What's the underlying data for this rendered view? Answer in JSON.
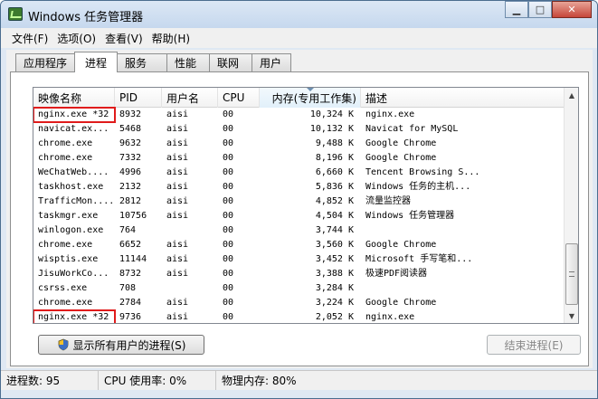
{
  "window": {
    "title": "Windows 任务管理器"
  },
  "menu": [
    "文件(F)",
    "选项(O)",
    "查看(V)",
    "帮助(H)"
  ],
  "tabs": [
    {
      "label": "应用程序",
      "active": false
    },
    {
      "label": "进程",
      "active": true
    },
    {
      "label": "服务",
      "active": false
    },
    {
      "label": "性能",
      "active": false
    },
    {
      "label": "联网",
      "active": false
    },
    {
      "label": "用户",
      "active": false
    }
  ],
  "columns": [
    {
      "key": "image",
      "label": "映像名称"
    },
    {
      "key": "pid",
      "label": "PID"
    },
    {
      "key": "user",
      "label": "用户名"
    },
    {
      "key": "cpu",
      "label": "CPU"
    },
    {
      "key": "mem",
      "label": "内存(专用工作集)"
    },
    {
      "key": "desc",
      "label": "描述"
    }
  ],
  "processes": [
    {
      "image": "nginx.exe *32",
      "pid": "8932",
      "user": "aisi",
      "cpu": "00",
      "mem": "10,324 K",
      "desc": "nginx.exe",
      "highlight": true
    },
    {
      "image": "navicat.ex...",
      "pid": "5468",
      "user": "aisi",
      "cpu": "00",
      "mem": "10,132 K",
      "desc": "Navicat for MySQL"
    },
    {
      "image": "chrome.exe",
      "pid": "9632",
      "user": "aisi",
      "cpu": "00",
      "mem": "9,488 K",
      "desc": "Google Chrome"
    },
    {
      "image": "chrome.exe",
      "pid": "7332",
      "user": "aisi",
      "cpu": "00",
      "mem": "8,196 K",
      "desc": "Google Chrome"
    },
    {
      "image": "WeChatWeb....",
      "pid": "4996",
      "user": "aisi",
      "cpu": "00",
      "mem": "6,660 K",
      "desc": "Tencent Browsing S..."
    },
    {
      "image": "taskhost.exe",
      "pid": "2132",
      "user": "aisi",
      "cpu": "00",
      "mem": "5,836 K",
      "desc": "Windows 任务的主机..."
    },
    {
      "image": "TrafficMon....",
      "pid": "2812",
      "user": "aisi",
      "cpu": "00",
      "mem": "4,852 K",
      "desc": "流量监控器"
    },
    {
      "image": "taskmgr.exe",
      "pid": "10756",
      "user": "aisi",
      "cpu": "00",
      "mem": "4,504 K",
      "desc": "Windows 任务管理器"
    },
    {
      "image": "winlogon.exe",
      "pid": "764",
      "user": "",
      "cpu": "00",
      "mem": "3,744 K",
      "desc": ""
    },
    {
      "image": "chrome.exe",
      "pid": "6652",
      "user": "aisi",
      "cpu": "00",
      "mem": "3,560 K",
      "desc": "Google Chrome"
    },
    {
      "image": "wisptis.exe",
      "pid": "11144",
      "user": "aisi",
      "cpu": "00",
      "mem": "3,452 K",
      "desc": "Microsoft 手写笔和..."
    },
    {
      "image": "JisuWorkCo...",
      "pid": "8732",
      "user": "aisi",
      "cpu": "00",
      "mem": "3,388 K",
      "desc": "极速PDF阅读器"
    },
    {
      "image": "csrss.exe",
      "pid": "708",
      "user": "",
      "cpu": "00",
      "mem": "3,284 K",
      "desc": ""
    },
    {
      "image": "chrome.exe",
      "pid": "2784",
      "user": "aisi",
      "cpu": "00",
      "mem": "3,224 K",
      "desc": "Google Chrome"
    },
    {
      "image": "nginx.exe *32",
      "pid": "9736",
      "user": "aisi",
      "cpu": "00",
      "mem": "2,052 K",
      "desc": "nginx.exe",
      "highlight": true
    }
  ],
  "buttons": {
    "show_all": "显示所有用户的进程(S)",
    "end_process": "结束进程(E)"
  },
  "status": {
    "processes": "进程数: 95",
    "cpu": "CPU 使用率: 0%",
    "memory": "物理内存: 80%"
  },
  "colors": {
    "highlight": "#e01b1b"
  }
}
